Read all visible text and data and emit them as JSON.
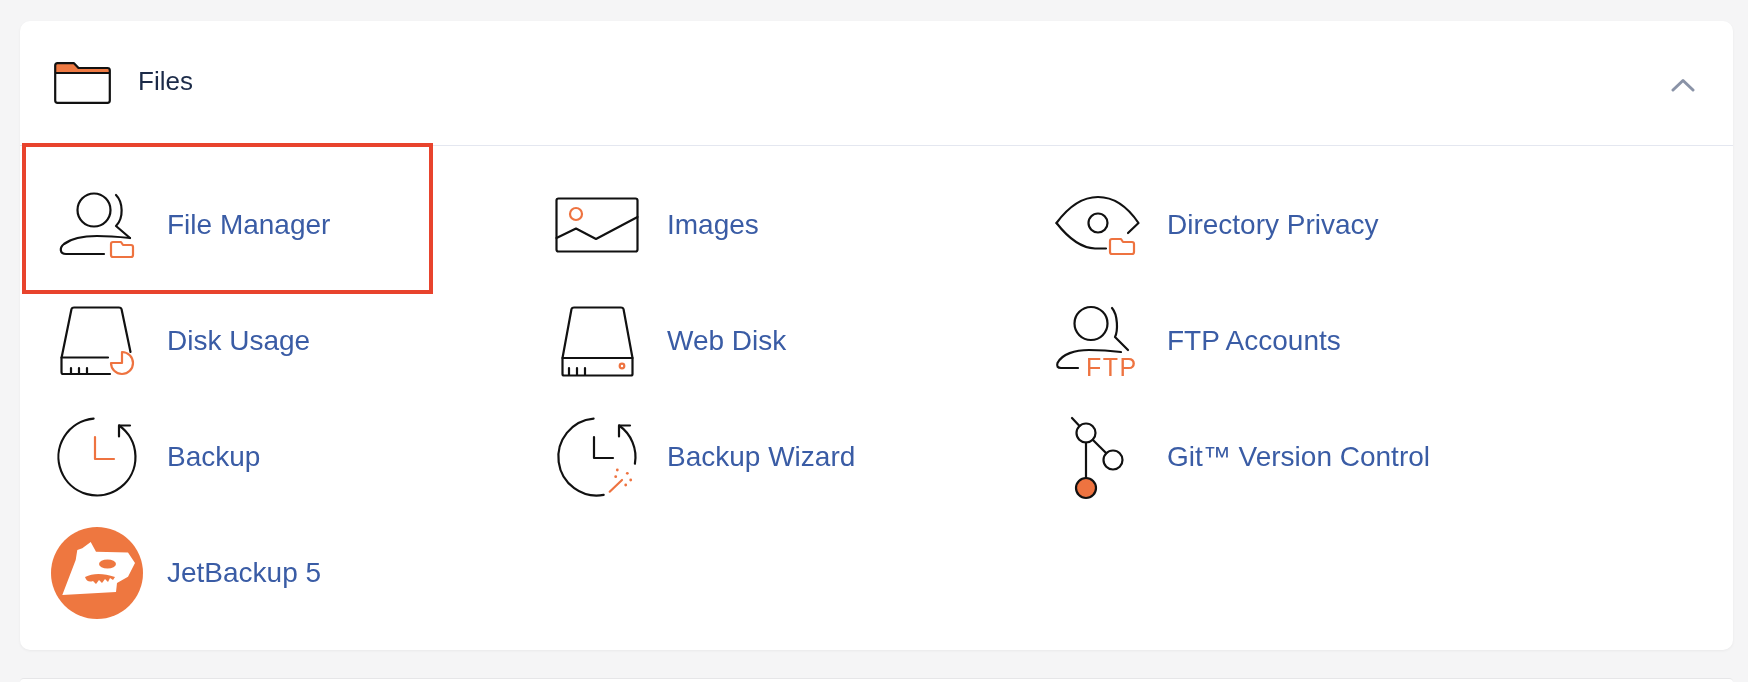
{
  "section": {
    "title": "Files",
    "expanded": true,
    "items": [
      {
        "label": "File Manager",
        "highlighted": true
      },
      {
        "label": "Images",
        "highlighted": false
      },
      {
        "label": "Directory Privacy",
        "highlighted": false
      },
      {
        "label": "Disk Usage",
        "highlighted": false
      },
      {
        "label": "Web Disk",
        "highlighted": false
      },
      {
        "label": "FTP Accounts",
        "highlighted": false,
        "icon_text": "FTP"
      },
      {
        "label": "Backup",
        "highlighted": false
      },
      {
        "label": "Backup Wizard",
        "highlighted": false
      },
      {
        "label": "Git™ Version Control",
        "highlighted": false
      },
      {
        "label": "JetBackup 5",
        "highlighted": false
      }
    ]
  }
}
